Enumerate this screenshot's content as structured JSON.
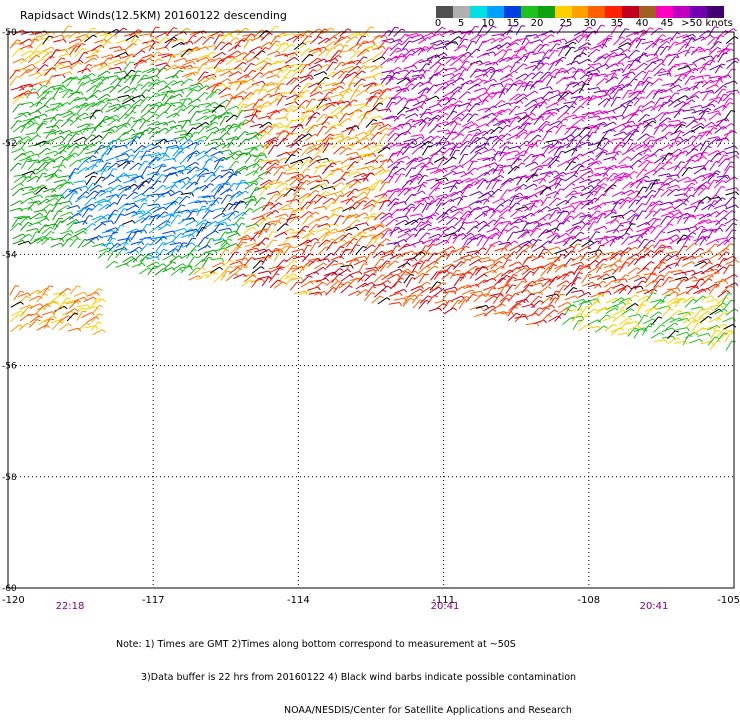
{
  "title": "Rapidsact Winds(12.5KM) 20160122 descending",
  "legend": {
    "colors": [
      "#505050",
      "#b0b0b0",
      "#00e0e0",
      "#00a0ff",
      "#0040e0",
      "#20c020",
      "#10a010",
      "#ffd000",
      "#ffa000",
      "#ff6000",
      "#ff2000",
      "#c00020",
      "#a06020",
      "#ff00c0",
      "#c000c0",
      "#7000b0",
      "#400070"
    ],
    "labels": [
      "0",
      "5",
      "10",
      "15",
      "20",
      "25",
      "30",
      "35",
      "40",
      "45",
      ">50 knots"
    ]
  },
  "axes": {
    "lon_ticks": [
      "-120",
      "-117",
      "-114",
      "-111",
      "-108",
      "-105"
    ],
    "lat_ticks": [
      "-50",
      "-52",
      "-54",
      "-56",
      "-58",
      "-60"
    ]
  },
  "times": [
    "22:18",
    "20:41",
    "20:41"
  ],
  "notes": [
    "Note: 1) Times are GMT 2)Times along bottom correspond to measurement at ~50S",
    "3)Data buffer is 22 hrs from 20160122 4) Black wind barbs indicate possible contamination",
    "NOAA/NESDIS/Center for Satellite Applications and Research"
  ]
}
